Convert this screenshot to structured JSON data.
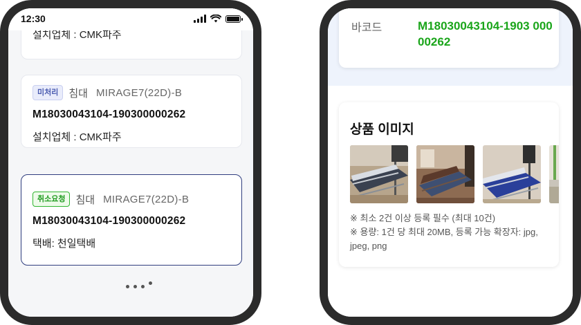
{
  "left": {
    "status": {
      "time": "12:30"
    },
    "cards": [
      {
        "installer": "설치업체 : CMK파주"
      },
      {
        "badge": "미처리",
        "type": "침대",
        "model": "MIRAGE7(22D)-B",
        "barcode": "M18030043104-190300000262",
        "info": "설치업체 : CMK파주"
      },
      {
        "badge": "취소요청",
        "type": "침대",
        "model": "MIRAGE7(22D)-B",
        "barcode": "M18030043104-190300000262",
        "info": "택배: 천일택배"
      }
    ]
  },
  "right": {
    "barcode": {
      "label": "바코드",
      "value": "M18030043104-1903 00000262"
    },
    "images": {
      "title": "상품 이미지",
      "thumbs": [
        "bed-photo-1",
        "bed-photo-2",
        "bed-photo-3",
        "bed-photo-4"
      ],
      "notice_line1": "※ 최소 2건 이상 등록 필수 (최대 10건)",
      "notice_line2": "※ 용량: 1건 당 최대 20MB, 등록 가능 확장자: jpg, jpeg, png"
    }
  },
  "colors": {
    "accent_green": "#1aa51a",
    "selected_border": "#2f3d7e",
    "badge_blue": "#4a5bb0"
  }
}
